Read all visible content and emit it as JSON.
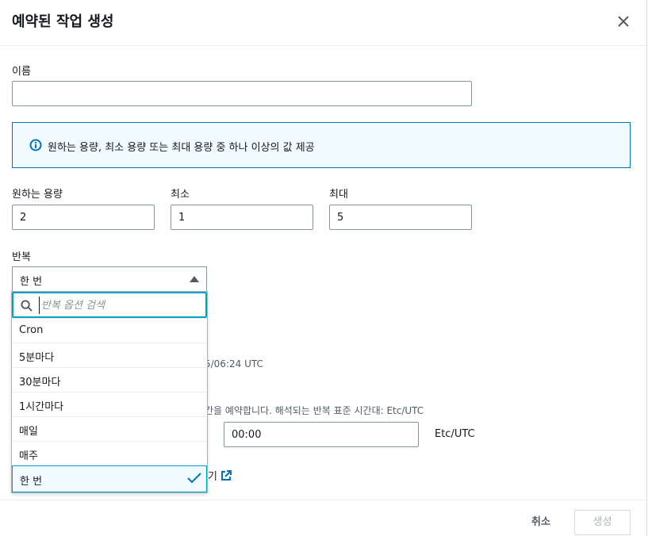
{
  "dialog": {
    "title": "예약된 작업 생성"
  },
  "form": {
    "name_label": "이름",
    "name_value": "",
    "info_text": "원하는 용량, 최소 용량 또는 최대 용량 중 하나 이상의 값 제공",
    "desired_label": "원하는 용량",
    "desired_value": "2",
    "min_label": "최소",
    "min_value": "1",
    "max_label": "최대",
    "max_value": "5",
    "recurrence_label": "반복",
    "recurrence_selected": "한 번",
    "recurrence_search_placeholder": "반복 옵션 검색",
    "recurrence_options": [
      "Cron",
      "5분마다",
      "30분마다",
      "1시간마다",
      "매일",
      "매주",
      "한 번"
    ],
    "partial_time_text": "5/06:24 UTC",
    "partial_tz_text": "간을 예약합니다. 해석되는 반복 표준 시간대: Etc/UTC",
    "time_value": "00:00",
    "timezone_label": "Etc/UTC",
    "partial_link_text": "기"
  },
  "footer": {
    "cancel_label": "취소",
    "create_label": "생성"
  },
  "colors": {
    "accent": "#0073bb",
    "focus": "#00a1c9",
    "info_bg": "#f1faff"
  }
}
